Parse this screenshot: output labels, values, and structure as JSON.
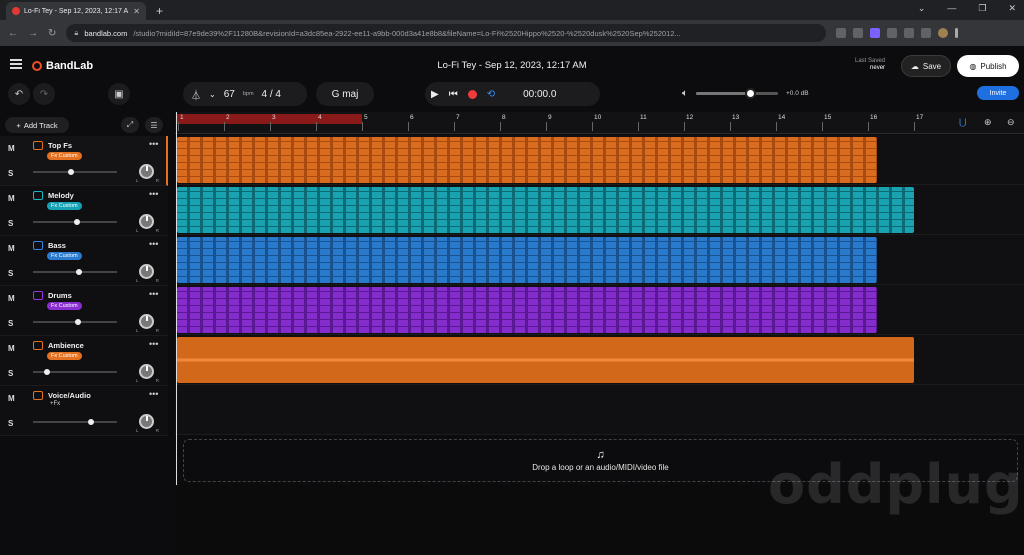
{
  "browser": {
    "tab_title": "Lo-Fi Tey - Sep 12, 2023, 12:17 A",
    "url_host": "bandlab.com",
    "url_path": "/studio?midiId=87e9de39%2F11280B&revisionId=a3dc85ea-2922-ee11-a9bb-000d3a41e8b8&fileName=Lo-Fi%2520Hippo%2520-%2520dusk%2520Sep%252012..."
  },
  "header": {
    "logo": "BandLab",
    "project_title": "Lo-Fi Tey - Sep 12, 2023, 12:17 AM",
    "last_saved_label": "Last Saved",
    "last_saved_value": "never",
    "save_label": "Save",
    "publish_label": "Publish",
    "invite_label": "Invite"
  },
  "toolbar": {
    "bpm": "67",
    "bpm_unit": "bpm",
    "time_signature": "4 / 4",
    "key": "G maj",
    "time": "00:00.0",
    "volume_db": "+0.0 dB",
    "volume_level": 0.66
  },
  "left": {
    "add_track_label": "Add Track"
  },
  "tracks": [
    {
      "name": "Top Fs",
      "fx": "Fx Custom",
      "fx_color": "#e4711f",
      "icon_color": "#e4711f",
      "volume": 0.45,
      "fx_badge": true
    },
    {
      "name": "Melody",
      "fx": "Fx Custom",
      "fx_color": "#16a2b4",
      "icon_color": "#19b6c6",
      "volume": 0.52,
      "fx_badge": true
    },
    {
      "name": "Bass",
      "fx": "Fx Custom",
      "fx_color": "#2a7ad0",
      "icon_color": "#2f86e8",
      "volume": 0.55,
      "fx_badge": true
    },
    {
      "name": "Drums",
      "fx": "Fx Custom",
      "fx_color": "#8a2ed0",
      "icon_color": "#9b35e0",
      "volume": 0.53,
      "fx_badge": true
    },
    {
      "name": "Ambience",
      "fx": "Fx Custom",
      "fx_color": "#e4711f",
      "icon_color": "#e4711f",
      "volume": 0.17,
      "fx_badge": true
    },
    {
      "name": "Voice/Audio",
      "fx": "+Fx",
      "fx_color": "",
      "icon_color": "#e4711f",
      "volume": 0.69,
      "fx_badge": false
    }
  ],
  "m_label": "M",
  "s_label": "S",
  "pan_l": "L",
  "pan_r": "R",
  "ruler_bars": [
    "1",
    "2",
    "3",
    "4",
    "5",
    "6",
    "7",
    "8",
    "9",
    "10",
    "11",
    "12",
    "13",
    "14",
    "15",
    "16",
    "17"
  ],
  "clips": [
    {
      "lane": 0,
      "color": "#e4711f",
      "dark": "#b24f10",
      "end_bar": 16.2
    },
    {
      "lane": 1,
      "color": "#1aaab8",
      "dark": "#0d6f7a",
      "end_bar": 17.0
    },
    {
      "lane": 2,
      "color": "#2b80d6",
      "dark": "#1a5696",
      "end_bar": 16.2
    },
    {
      "lane": 3,
      "color": "#8c2fd6",
      "dark": "#5e1a9a",
      "end_bar": 16.2
    },
    {
      "lane": 4,
      "color": "#d2691a",
      "dark": "#a04a0c",
      "end_bar": 17.0
    }
  ],
  "dropzone_label": "Drop a loop or an audio/MIDI/video file",
  "watermark": "oddplug"
}
